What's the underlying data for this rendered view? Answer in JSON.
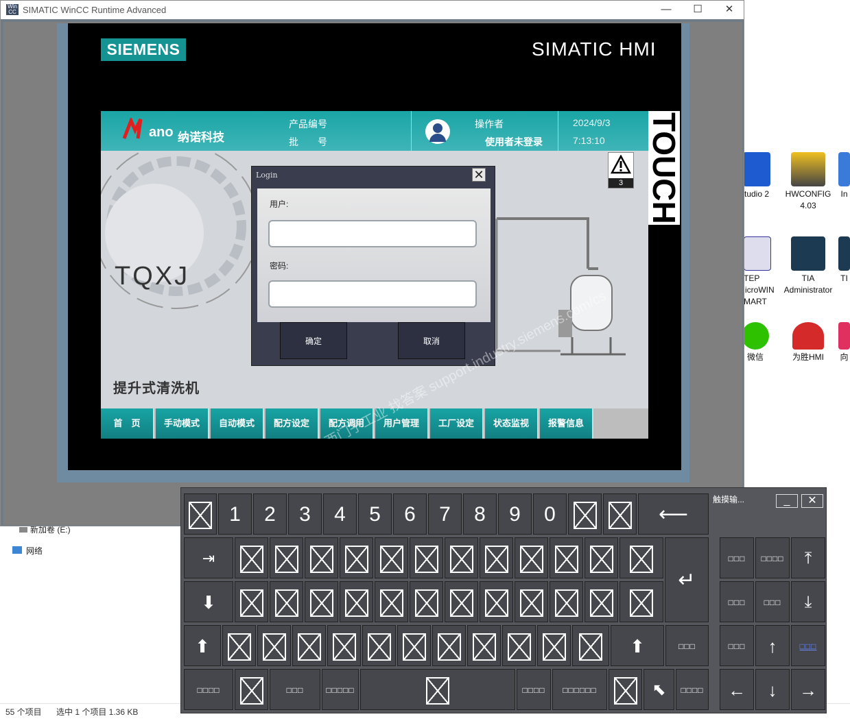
{
  "window": {
    "title": "SIMATIC WinCC Runtime Advanced",
    "minimize": "—",
    "maximize": "☐",
    "close": "✕"
  },
  "hmi": {
    "brand": "SIEMENS",
    "title": "SIMATIC HMI",
    "touch": "TOUCH"
  },
  "header": {
    "company": "纳诺科技",
    "product_label": "产品编号",
    "batch_label": "批　　号",
    "operator_label": "操作者",
    "operator_value": "使用者未登录",
    "date": "2024/9/3",
    "time": "7:13:10"
  },
  "alarm": {
    "count": "3"
  },
  "screen": {
    "logo_text": "TQXJ",
    "machine_title": "提升式清洗机"
  },
  "nav": [
    "首　页",
    "手动模式",
    "自动模式",
    "配方设定",
    "配方调用",
    "用户管理",
    "工厂设定",
    "状态监视",
    "报警信息"
  ],
  "login": {
    "title": "Login",
    "user_label": "用户:",
    "password_label": "密码:",
    "ok": "确定",
    "cancel": "取消"
  },
  "keyboard": {
    "title": "触摸输...",
    "digits": [
      "1",
      "2",
      "3",
      "4",
      "5",
      "6",
      "7",
      "8",
      "9",
      "0"
    ],
    "labels": {
      "k1": "□□□",
      "k2": "□□□□",
      "k3": "□□□",
      "k4": "□□□",
      "k5": "□□□",
      "k6": "□□□",
      "k7": "□□□□",
      "k8": "□□□",
      "k9": "□□□□□",
      "k10": "□□□□",
      "k11": "□□□□□□",
      "k12": "□□□□"
    }
  },
  "desktop": {
    "icons": [
      {
        "label": "tudio 2"
      },
      {
        "label": "HWCONFIG 4.03"
      },
      {
        "label": "In"
      },
      {
        "label": "STEP MicroWIN SMART"
      },
      {
        "label": "TIA Administrator"
      },
      {
        "label": "TI"
      },
      {
        "label": "微信"
      },
      {
        "label": "为胜HMI"
      },
      {
        "label": "向"
      }
    ],
    "drive": "新加卷 (E:)",
    "network": "网络",
    "status_count": "55 个项目",
    "status_selected": "选中 1 个项目  1.36 KB"
  },
  "watermark": "西门子工业 找答案 support.industry.siemens.com/cs"
}
